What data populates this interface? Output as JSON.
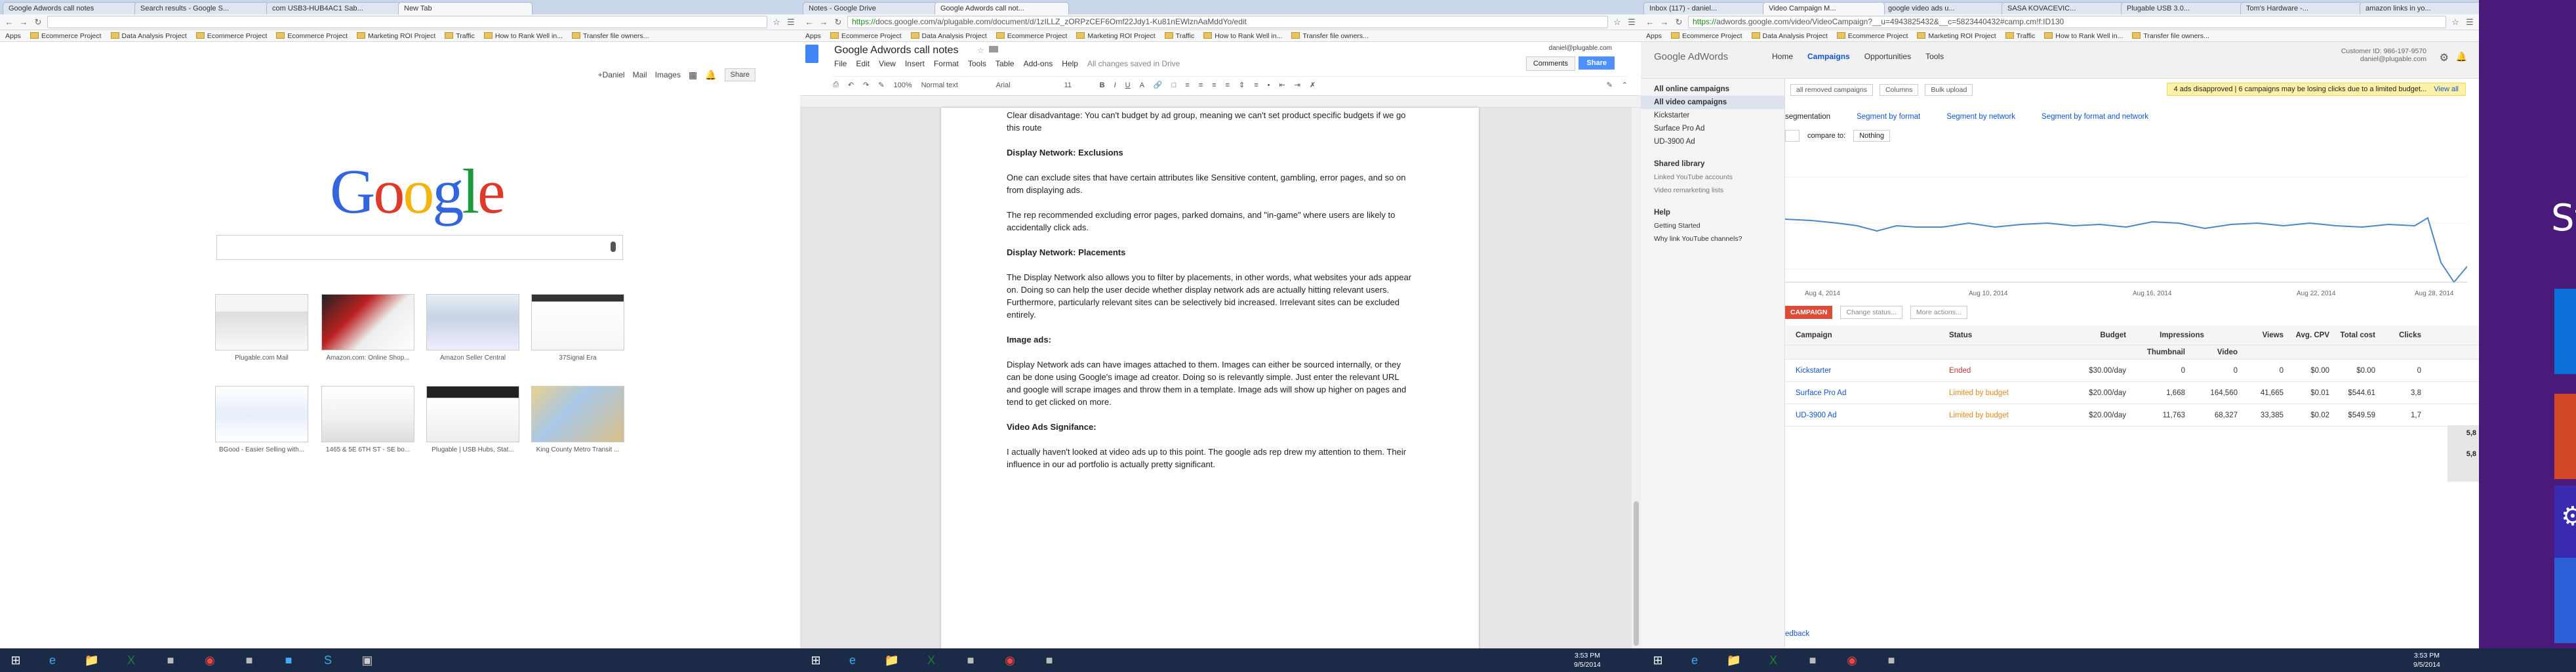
{
  "window1": {
    "tabs": [
      "Google Adwords call notes",
      "Search results - Google S...",
      "com USB3-HUB4AC1 Sab...",
      "New Tab"
    ],
    "url": "",
    "bookmarks": [
      "Apps",
      "Ecommerce Project",
      "Data Analysis Project",
      "Ecommerce Project",
      "Ecommerce Project",
      "Marketing ROI Project",
      "Traffic",
      "How to Rank Well in...",
      "Transfer file owners..."
    ],
    "header_links": [
      "+Daniel",
      "Mail",
      "Images"
    ],
    "logo": "Google",
    "thumbnails": [
      "Plugable.com Mail",
      "Amazon.com: Online Shop...",
      "Amazon Seller Central",
      "37Signal Era",
      "BGood - Easier Selling with...",
      "1465 & 5E 6TH ST - SE bo...",
      "Plugable | USB Hubs, Stat...",
      "King County Metro Transit ..."
    ]
  },
  "window2": {
    "tabs": [
      "Notes - Google Drive",
      "Google Adwords call not..."
    ],
    "url_scheme": "https://",
    "url_rest": "docs.google.com/a/plugable.com/document/d/1zILLZ_zORPzCEF6Omf22Jdy1-Ku81nEWlznAaMddYo/edit",
    "doc_title": "Google Adwords call notes",
    "menu": [
      "File",
      "Edit",
      "View",
      "Insert",
      "Format",
      "Tools",
      "Table",
      "Add-ons",
      "Help"
    ],
    "save_status": "All changes saved in Drive",
    "user": "daniel@plugable.com",
    "comments_label": "Comments",
    "share_label": "Share",
    "toolbar": {
      "zoom": "100%",
      "style": "Normal text",
      "font": "Arial",
      "size": "11"
    },
    "paragraphs": [
      {
        "heading": false,
        "text": "Clear disadvantage: You can't budget by ad group, meaning we can't set product specific budgets if we go this route"
      },
      {
        "heading": true,
        "text": "Display Network: Exclusions"
      },
      {
        "heading": false,
        "text": "One can exclude sites that have certain attributes like Sensitive content, gambling, error pages, and so on from displaying ads."
      },
      {
        "heading": false,
        "text": "The rep recommended excluding error pages, parked domains, and \"in-game\" where users are likely to accidentally click ads."
      },
      {
        "heading": true,
        "text": "Display Network: Placements"
      },
      {
        "heading": false,
        "text": "The Display Network also allows you to filter by placements, in other words, what websites your ads appear on. Doing so can help the user decide whether display network ads are actually hitting relevant users. Furthermore, particularly relevant sites can be selectively bid increased. Irrelevant sites can be excluded entirely."
      },
      {
        "heading": true,
        "text": "Image ads:"
      },
      {
        "heading": false,
        "text": "Display Network ads can have images attached to them. Images can either be sourced internally, or they can be done using Google's image ad creator. Doing so is relevantly simple. Just enter the relevant URL and google will scrape images and throw them in a template. Image ads will show up higher on pages and tend to get clicked on more."
      },
      {
        "heading": true,
        "text": "Video Ads Signifance:"
      },
      {
        "heading": false,
        "text": "I actually haven't looked at video ads up to this point. The google ads rep drew my attention to them. Their influence in our ad portfolio is actually pretty significant."
      }
    ]
  },
  "window3": {
    "tabs": [
      "Inbox (117) - daniel...",
      "Video Campaign M...",
      "google video ads u...",
      "SASA KOVACEVIC...",
      "Plugable USB 3.0...",
      "Tom's Hardware -...",
      "amazon links in yo..."
    ],
    "url_scheme": "https://",
    "url_rest": "adwords.google.com/video/VideoCampaign?__u=4943825432&__c=5823440432#camp.cm!f:ID130",
    "product": "Google AdWords",
    "nav": [
      "Home",
      "Campaigns",
      "Opportunities",
      "Tools"
    ],
    "customer_id": "Customer ID: 986-197-9570",
    "customer_email": "daniel@plugable.com",
    "alert": "4 ads disapproved | 6 campaigns may be losing clicks due to a limited budget...",
    "alert_link": "View all",
    "sidebar": {
      "all_online": "All online campaigns",
      "all_video": "All video campaigns",
      "campaigns": [
        "Kickstarter",
        "Surface Pro Ad",
        "UD-3900 Ad"
      ],
      "shared_title": "Shared library",
      "shared_items": [
        "Linked YouTube accounts",
        "Video remarketing lists"
      ],
      "help_title": "Help",
      "help_items": [
        "Getting Started",
        "Why link YouTube channels?"
      ]
    },
    "segment_links": [
      "Segment by format",
      "Segment by network",
      "Segment by format and network"
    ],
    "segmentation_label": "segmentation",
    "compare_label": "compare to:",
    "compare_value": "Nothing",
    "dropdowns": [
      "all removed campaigns",
      "Columns",
      "Bulk upload"
    ],
    "chart_dates": [
      "Aug 4, 2014",
      "Aug 10, 2014",
      "Aug 16, 2014",
      "Aug 22, 2014",
      "Aug 28, 2014"
    ],
    "campaign_button": "CAMPAIGN",
    "change_status": "Change status...",
    "more_actions": "More actions...",
    "table": {
      "headers": [
        "Campaign",
        "Status",
        "Budget",
        "Impressions",
        "Views",
        "Avg. CPV",
        "Total cost",
        "Clicks"
      ],
      "subheaders": [
        "Thumbnail",
        "Video"
      ],
      "rows": [
        [
          "Kickstarter",
          "Ended",
          "$30.00/day",
          "0",
          "0",
          "0",
          "$0.00",
          "$0.00",
          "0"
        ],
        [
          "Surface Pro Ad",
          "Limited by budget",
          "$20.00/day",
          "1,668",
          "164,560",
          "41,665",
          "$0.01",
          "$544.61",
          "3,8"
        ],
        [
          "UD-3900 Ad",
          "Limited by budget",
          "$20.00/day",
          "11,763",
          "68,327",
          "33,385",
          "$0.02",
          "$549.59",
          "1,7"
        ]
      ],
      "totals": [
        "5,8",
        "5,8"
      ]
    },
    "feedback": "edback"
  },
  "taskbar": {
    "time": "3:53 PM",
    "date": "9/5/2014",
    "time2": "3:53 PM",
    "date2": "9/5/2014"
  },
  "startscreen": {
    "label": "St"
  }
}
